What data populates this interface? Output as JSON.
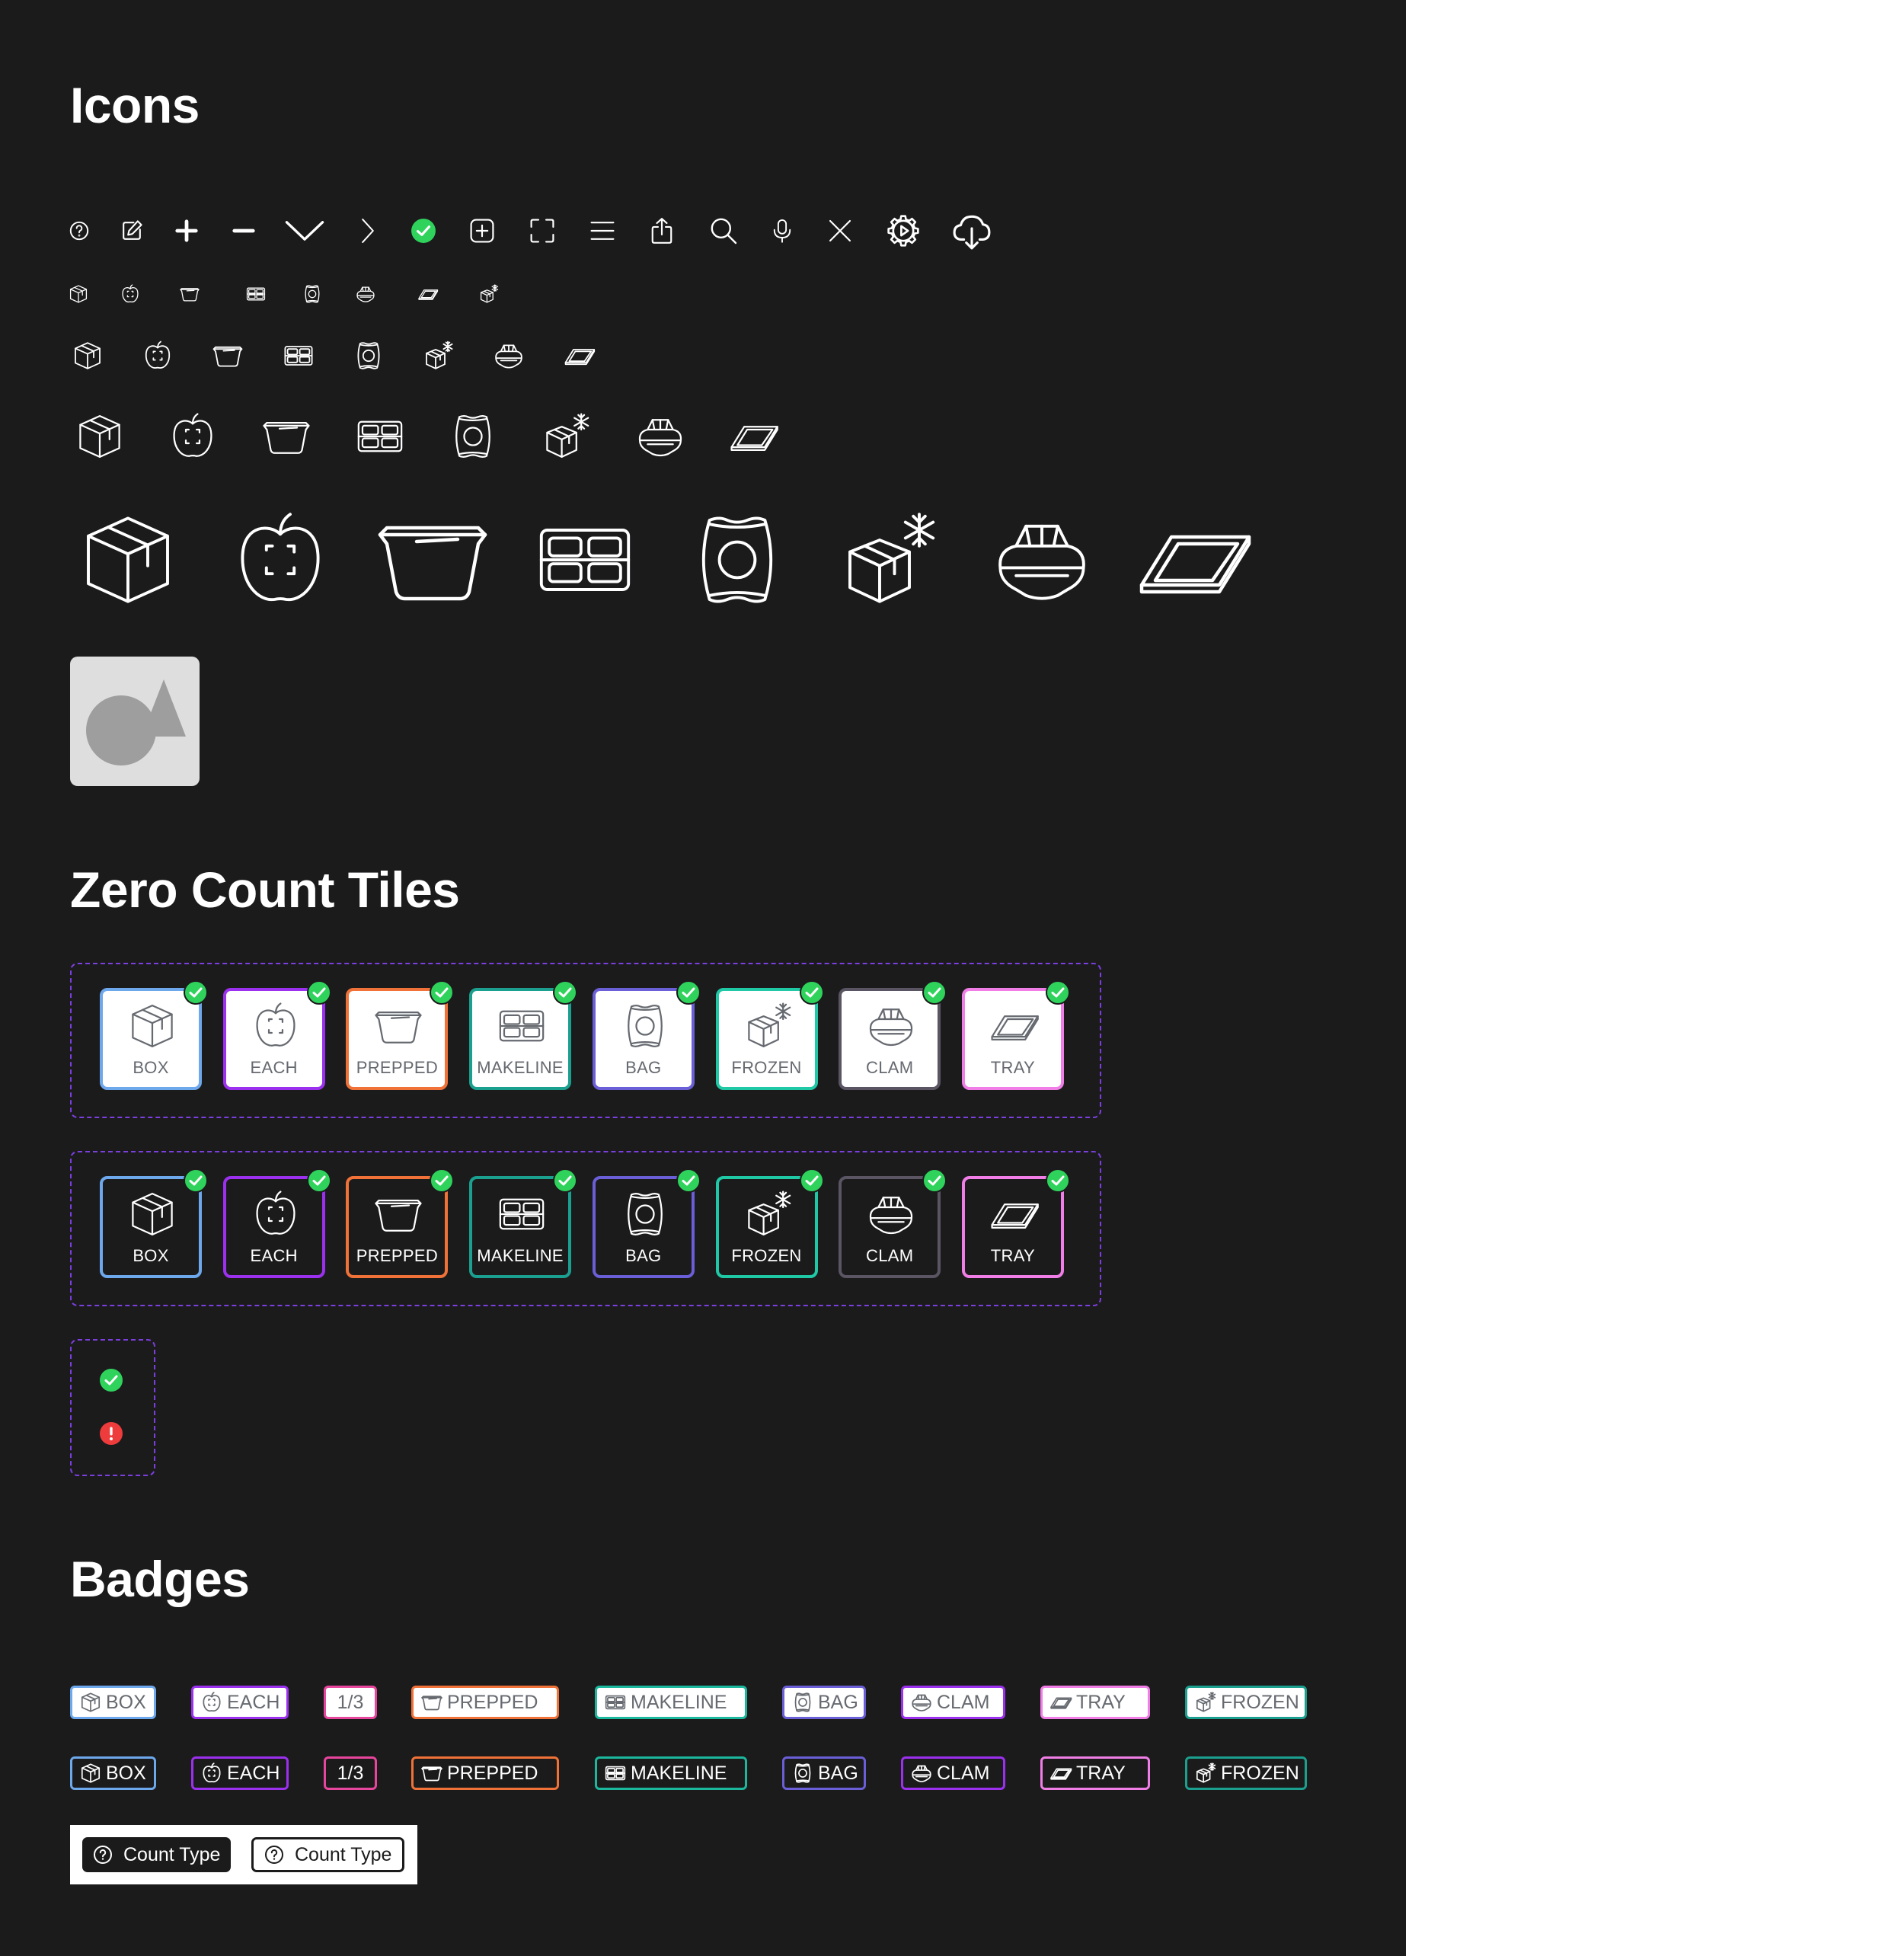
{
  "sections": {
    "icons_title": "Icons",
    "tiles_title": "Zero Count Tiles",
    "badges_title": "Badges"
  },
  "ui_icons": [
    "help-circle-icon",
    "edit-icon",
    "plus-icon",
    "minus-icon",
    "chevron-down-icon",
    "chevron-right-icon",
    "check-circle-icon",
    "plus-square-icon",
    "focus-frame-icon",
    "menu-icon",
    "share-icon",
    "search-icon",
    "microphone-icon",
    "close-icon",
    "settings-icon",
    "cloud-download-icon"
  ],
  "count_type_icons": [
    "box-icon",
    "apple-icon",
    "prepped-pan-icon",
    "makeline-icon",
    "bag-icon",
    "frozen-icon",
    "clam-icon",
    "tray-icon"
  ],
  "colors": {
    "background": "#1b1b1c",
    "box": "#6ea8ec",
    "each": "#9b30ee",
    "prepped": "#f07238",
    "makeline": "#1bb89d",
    "bag": "#6a5fd6",
    "frozen": "#20c9a6",
    "clam": "#5b5563",
    "tray": "#f07ee6",
    "one_third": "#e8459c",
    "success": "#2fd35c",
    "error": "#ee3b3b",
    "dashed_border": "#7b3fe0"
  },
  "tiles": [
    {
      "label": "BOX",
      "icon": "box-icon",
      "color": "#6ea8ec"
    },
    {
      "label": "EACH",
      "icon": "apple-icon",
      "color": "#9b30ee"
    },
    {
      "label": "PREPPED",
      "icon": "prepped-pan-icon",
      "color": "#f07238"
    },
    {
      "label": "MAKELINE",
      "icon": "makeline-icon",
      "color": "#1b9f8f"
    },
    {
      "label": "BAG",
      "icon": "bag-icon",
      "color": "#6a5fd6"
    },
    {
      "label": "FROZEN",
      "icon": "frozen-icon",
      "color": "#20c9a6"
    },
    {
      "label": "CLAM",
      "icon": "clam-icon",
      "color": "#5b5563"
    },
    {
      "label": "TRAY",
      "icon": "tray-icon",
      "color": "#f07ee6"
    }
  ],
  "status_icons": [
    "success-check-icon",
    "error-alert-icon"
  ],
  "badges": [
    {
      "label": "BOX",
      "icon": "box-icon",
      "color": "#6ea8ec"
    },
    {
      "label": "EACH",
      "icon": "apple-icon",
      "color": "#9b30ee"
    },
    {
      "label": "1/3",
      "icon": "",
      "color": "#e8459c"
    },
    {
      "label": "PREPPED",
      "icon": "prepped-pan-icon",
      "color": "#f07238"
    },
    {
      "label": "MAKELINE",
      "icon": "makeline-icon",
      "color": "#1bb89d"
    },
    {
      "label": "BAG",
      "icon": "bag-icon",
      "color": "#6a5fd6"
    },
    {
      "label": "CLAM",
      "icon": "clam-icon",
      "color": "#9b30ee"
    },
    {
      "label": "TRAY",
      "icon": "tray-icon",
      "color": "#f07ee6"
    },
    {
      "label": "FROZEN",
      "icon": "frozen-icon",
      "color": "#1b9f8f"
    }
  ],
  "count_type_buttons": {
    "dark_label": "Count Type",
    "light_label": "Count Type"
  }
}
